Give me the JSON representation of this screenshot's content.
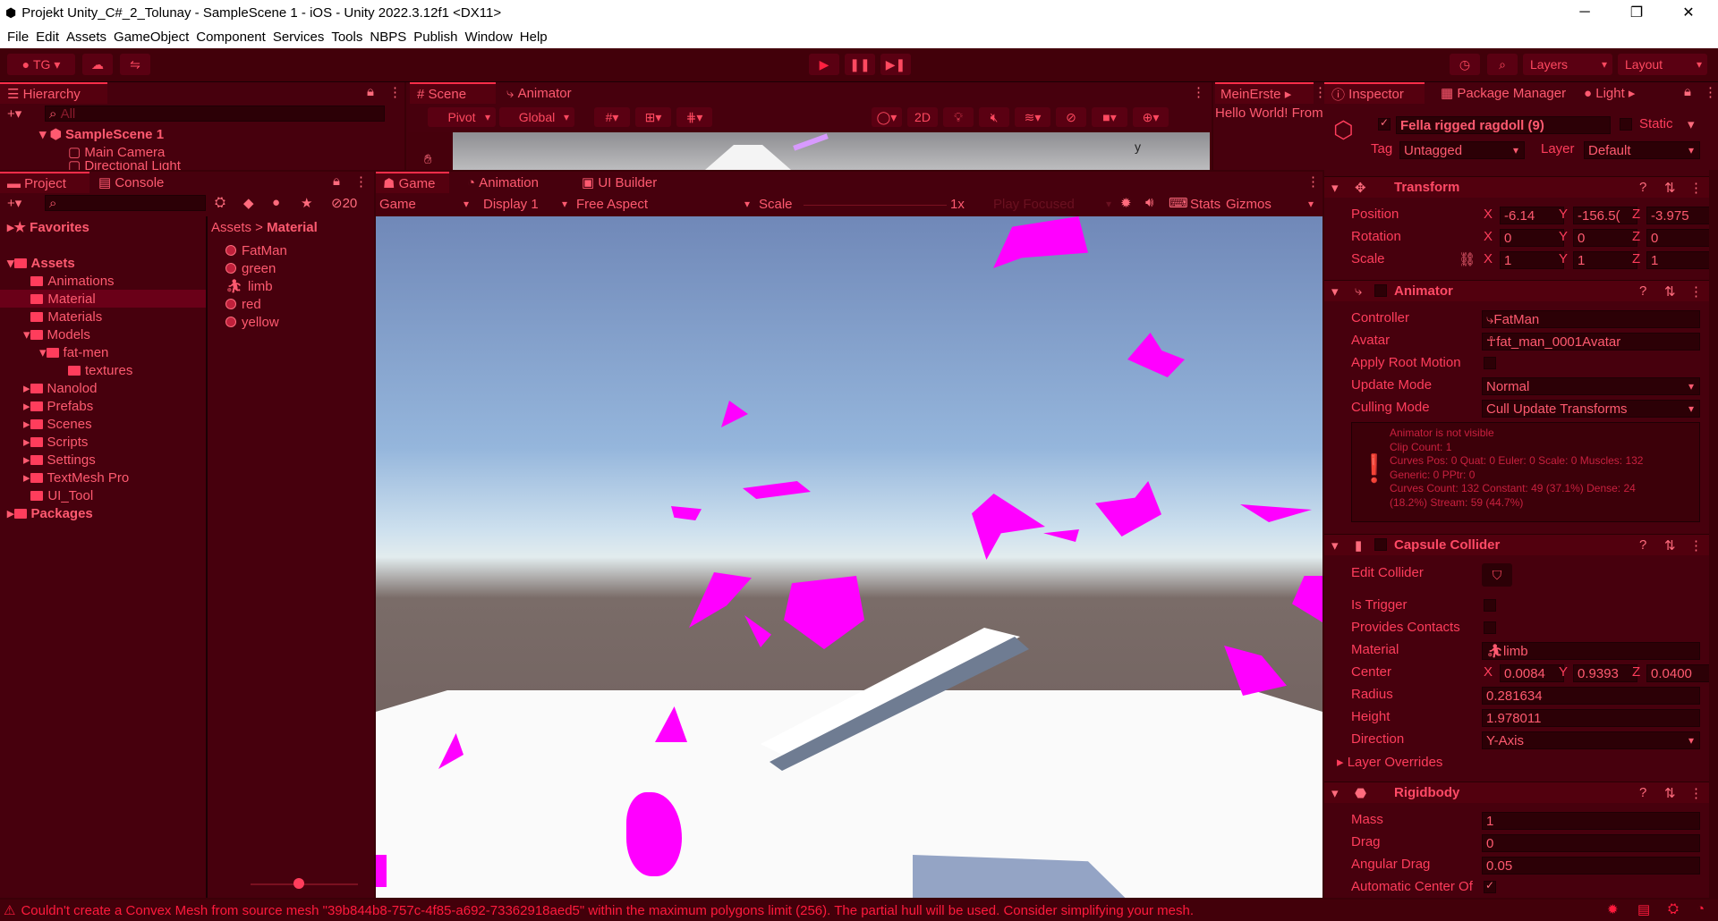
{
  "window": {
    "title": "Projekt Unity_C#_2_Tolunay - SampleScene 1 - iOS - Unity 2022.3.12f1 <DX11>",
    "minimize": "─",
    "restore": "❐",
    "close": "✕"
  },
  "menu": [
    "File",
    "Edit",
    "Assets",
    "GameObject",
    "Component",
    "Services",
    "Tools",
    "NBPS",
    "Publish",
    "Window",
    "Help"
  ],
  "toolbar": {
    "account": "TG",
    "layers": "Layers",
    "layout": "Layout"
  },
  "hierarchy": {
    "tab": "Hierarchy",
    "search_placeholder": "All",
    "scene": "SampleScene 1",
    "items": [
      "Main Camera",
      "Directional Light"
    ]
  },
  "scene": {
    "tabs": [
      "Scene",
      "Animator"
    ],
    "pivot": "Pivot",
    "global": "Global",
    "mode2d": "2D",
    "gizmo_axis": "y"
  },
  "side_panel": {
    "title": "MeinErste",
    "text": "Hello World! From"
  },
  "project": {
    "tabs": [
      "Project",
      "Console"
    ],
    "hidden_count": "20",
    "favorites": "Favorites",
    "assets": "Assets",
    "packages": "Packages",
    "folders": [
      "Animations",
      "Material",
      "Materials",
      "Models",
      "fat-men",
      "textures",
      "Nanolod",
      "Prefabs",
      "Scenes",
      "Scripts",
      "Settings",
      "TextMesh Pro",
      "UI_Tool"
    ],
    "breadcrumb": [
      "Assets",
      "Material"
    ],
    "files": [
      "FatMan",
      "green",
      "limb",
      "red",
      "yellow"
    ]
  },
  "game": {
    "tabs": [
      "Game",
      "Animation",
      "UI Builder"
    ],
    "mode": "Game",
    "display": "Display 1",
    "aspect": "Free Aspect",
    "scale_label": "Scale",
    "scale_value": "1x",
    "play_focused": "Play Focused",
    "stats": "Stats",
    "gizmos": "Gizmos"
  },
  "inspector": {
    "tabs": [
      "Inspector",
      "Package Manager",
      "Light"
    ],
    "object_name": "Fella rigged ragdoll (9)",
    "static_label": "Static",
    "tag_label": "Tag",
    "tag": "Untagged",
    "layer_label": "Layer",
    "layer": "Default",
    "transform": {
      "title": "Transform",
      "position_label": "Position",
      "rotation_label": "Rotation",
      "scale_label": "Scale",
      "position": [
        "-6.14",
        "-156.5(",
        "-3.975"
      ],
      "rotation": [
        "0",
        "0",
        "0"
      ],
      "scale": [
        "1",
        "1",
        "1"
      ]
    },
    "animator": {
      "title": "Animator",
      "controller_label": "Controller",
      "controller": "FatMan",
      "avatar_label": "Avatar",
      "avatar": "fat_man_0001Avatar",
      "root_motion_label": "Apply Root Motion",
      "update_mode_label": "Update Mode",
      "update_mode": "Normal",
      "culling_label": "Culling Mode",
      "culling": "Cull Update Transforms",
      "info": [
        "Animator is not visible",
        "Clip Count: 1",
        "Curves Pos: 0 Quat: 0 Euler: 0 Scale: 0 Muscles: 132",
        "Generic: 0 PPtr: 0",
        "Curves Count: 132 Constant: 49 (37.1%) Dense: 24",
        "(18.2%) Stream: 59 (44.7%)"
      ]
    },
    "capsule": {
      "title": "Capsule Collider",
      "edit_label": "Edit Collider",
      "trigger_label": "Is Trigger",
      "contacts_label": "Provides Contacts",
      "material_label": "Material",
      "material": "limb",
      "center_label": "Center",
      "center": [
        "0.0084",
        "0.9393",
        "0.0400"
      ],
      "radius_label": "Radius",
      "radius": "0.281634",
      "height_label": "Height",
      "height": "1.978011",
      "direction_label": "Direction",
      "direction": "Y-Axis",
      "overrides_label": "Layer Overrides"
    },
    "rigidbody": {
      "title": "Rigidbody",
      "mass_label": "Mass",
      "mass": "1",
      "drag_label": "Drag",
      "drag": "0",
      "angular_label": "Angular Drag",
      "angular": "0.05",
      "auto_center_label": "Automatic Center Of"
    }
  },
  "status": {
    "message": "Couldn't create a Convex Mesh from source mesh \"39b844b8-757c-4f85-a692-73362918aed5\" within the maximum polygons limit (256). The partial hull will be used. Consider simplifying your mesh."
  }
}
